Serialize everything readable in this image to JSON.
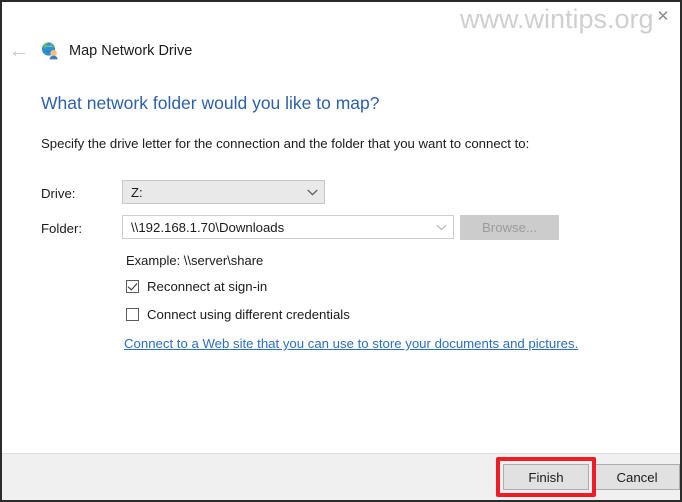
{
  "watermark": "www.wintips.org",
  "window": {
    "title": "Map Network Drive",
    "title_icon": "network-drive-icon",
    "back_icon": "back-arrow-icon",
    "close_icon": "close-icon"
  },
  "body": {
    "heading": "What network folder would you like to map?",
    "description": "Specify the drive letter for the connection and the folder that you want to connect to:",
    "example": "Example: \\\\server\\share",
    "link": "Connect to a Web site that you can use to store your documents and pictures."
  },
  "form": {
    "drive": {
      "label": "Drive:",
      "value": "Z:",
      "chevron": "chevron-down-icon"
    },
    "folder": {
      "label": "Folder:",
      "value": "\\\\192.168.1.70\\Downloads",
      "chevron": "chevron-down-icon",
      "browse_label": "Browse..."
    },
    "checkboxes": [
      {
        "label": "Reconnect at sign-in",
        "checked": true
      },
      {
        "label": "Connect using different credentials",
        "checked": false
      }
    ]
  },
  "footer": {
    "finish_label": "Finish",
    "cancel_label": "Cancel"
  },
  "colors": {
    "heading": "#2c5fad",
    "link": "#2b6fc4",
    "highlight": "#ee1c25",
    "footer_bg": "#f0f0f0"
  }
}
